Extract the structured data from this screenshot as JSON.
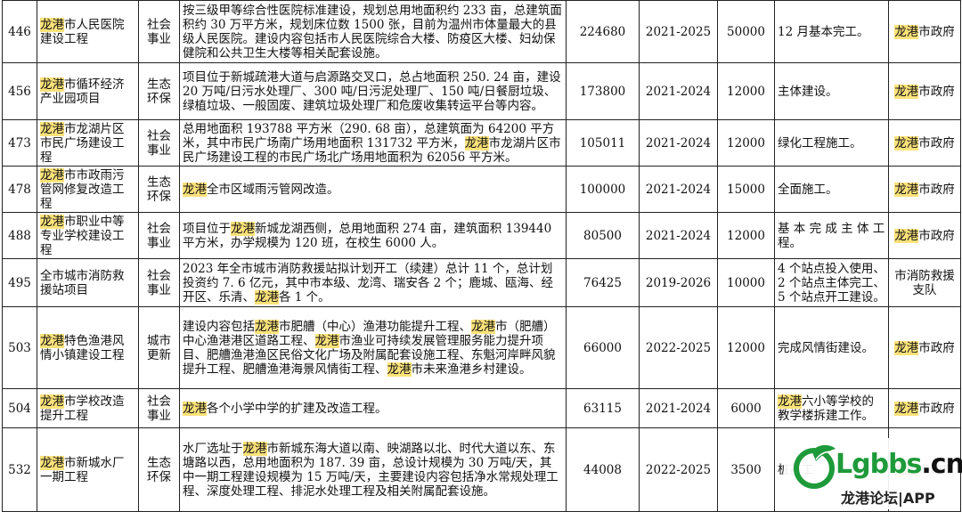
{
  "rows": [
    {
      "id": "446",
      "name": [
        "龙港",
        "市人民医院建设工程"
      ],
      "cat": "社会事业",
      "desc": [
        "按三级甲等综合性医院标准建设，规划总用地面积约 233 亩，总建筑面积约 30 万平方米，规划床位数 1500 张，目前为温州市体量最大的县级人民医院。建设内容包括市人民医院综合大楼、防疫区大楼、妇幼保健院和公共卫生大楼等相关配套设施。"
      ],
      "total": "224680",
      "period": "2021-2025",
      "invest": "50000",
      "target": "12 月基本完工。",
      "org": [
        "龙港",
        "市政府"
      ]
    },
    {
      "id": "456",
      "name": [
        "龙港",
        "市循环经济产业园项目"
      ],
      "cat": "生态环保",
      "desc": [
        "项目位于新城疏港大道与启源路交叉口，总占地面积 250. 24 亩，建设 20 万吨/日污水处理厂、300 吨/日污泥处理厂、150 吨/日餐厨垃圾、绿植垃圾、一般固废、建筑垃圾处理厂和危废收集转运平台等内容。"
      ],
      "total": "173800",
      "period": "2021-2024",
      "invest": "12000",
      "target": "主体建设。",
      "org": [
        "龙港",
        "市政府"
      ]
    },
    {
      "id": "473",
      "name": [
        "龙港",
        "市龙湖片区市民广场建设工程"
      ],
      "cat": "社会事业",
      "desc": [
        "总用地面积 193788 平方米（290. 68 亩），总建筑面为 64200 平方米，其中市民广场南广场用地面积 131732 平方米，",
        "龙港",
        "市龙湖片区市民广场建设工程的市民广场北广场用地面积为 62056 平方米。"
      ],
      "total": "105011",
      "period": "2021-2024",
      "invest": "12000",
      "target": "绿化工程施工。",
      "org": [
        "龙港",
        "市政府"
      ]
    },
    {
      "id": "478",
      "name": [
        "龙港",
        "市市政雨污管网修复改造工程"
      ],
      "cat": "生态环保",
      "desc": [
        "",
        "龙港",
        "全市区域雨污管网改造。"
      ],
      "total": "100000",
      "period": "2021-2024",
      "invest": "15000",
      "target": "全面施工。",
      "org": [
        "龙港",
        "市政府"
      ]
    },
    {
      "id": "488",
      "name": [
        "龙港",
        "市职业中等专业学校建设工程"
      ],
      "cat": "社会事业",
      "desc": [
        "项目位于",
        "龙港",
        "新城龙湖西侧，总用地面积 274 亩，建筑面积 139440 平方米，办学规模为 120 班，在校生 6000 人。"
      ],
      "total": "80500",
      "period": "2021-2024",
      "invest": "12000",
      "target": "基 本 完 成 主 体 工 程。",
      "org": [
        "龙港",
        "市政府"
      ]
    },
    {
      "id": "495",
      "name": [
        "",
        "全市城市消防救援站项目"
      ],
      "cat": "社会事业",
      "desc": [
        "2023 年全市城市消防救援站拟计划开工（续建）总计 11 个，总计划投资约 7. 6 亿元，其中市本级、龙湾、瑞安各 2 个；鹿城、瓯海、经开区、乐清、",
        "龙港",
        "各 1 个。"
      ],
      "total": "76425",
      "period": "2019-2026",
      "invest": "10000",
      "target": "4 个站点投入使用、2 个站点主体完工、5 个站点开工建设。",
      "org": [
        "",
        "市消防救援支队"
      ]
    },
    {
      "id": "503",
      "name": [
        "龙港",
        "特色渔港风情小镇建设工程"
      ],
      "cat": "城市更新",
      "desc": [
        "建设内容包括",
        "龙港",
        "市肥艚（中心）渔港功能提升工程、",
        "龙港",
        "市（肥艚）中心渔港港区道路工程、",
        "龙港",
        "市渔业可持续发展管理服务能力提升项目、肥艚渔港渔区民俗文化广场及附属配套设施工程、东魁河岸畔风貌提升工程、肥艚渔港海景风情街工程、",
        "龙港",
        "市未来渔港乡村建设。"
      ],
      "total": "66000",
      "period": "2022-2025",
      "invest": "12000",
      "target": "完成风情街建设。",
      "org": [
        "龙港",
        "市政府"
      ]
    },
    {
      "id": "504",
      "name": [
        "龙港",
        "市学校改造提升工程"
      ],
      "cat": "社会事业",
      "desc": [
        "",
        "龙港",
        "各个小学中学的扩建及改造工程。"
      ],
      "total": "63115",
      "period": "2021-2024",
      "invest": "6000",
      "target": "龙港六小等学校的教学楼拆建工作。",
      "org": [
        "龙港",
        "市政府"
      ]
    },
    {
      "id": "532",
      "name": [
        "龙港",
        "市新城水厂一期工程"
      ],
      "cat": "生态环保",
      "desc": [
        "水厂选址于",
        "龙港",
        "市新城东海大道以南、映湖路以北、时代大道以东、东塘路以西，总用地面积为 187. 39 亩，总设计规模为 30 万吨/天，其中一期工程建设规模为 15 万吨/天，主要建设内容包括净水常规处理工程、深度处理工程、排泥水处理工程及相关附属配套设施。"
      ],
      "total": "44008",
      "period": "2022-2025",
      "invest": "3500",
      "target": "桩基工",
      "org": [
        "龙港",
        "市政府"
      ]
    }
  ],
  "watermark": {
    "brand": "Lgbbs",
    "suffix": ".cn",
    "sub": "龙港论坛",
    "sub_suffix": "|APP"
  },
  "colors": {
    "highlight": "#fbe27a",
    "brand_green": "#1e9a3a"
  }
}
